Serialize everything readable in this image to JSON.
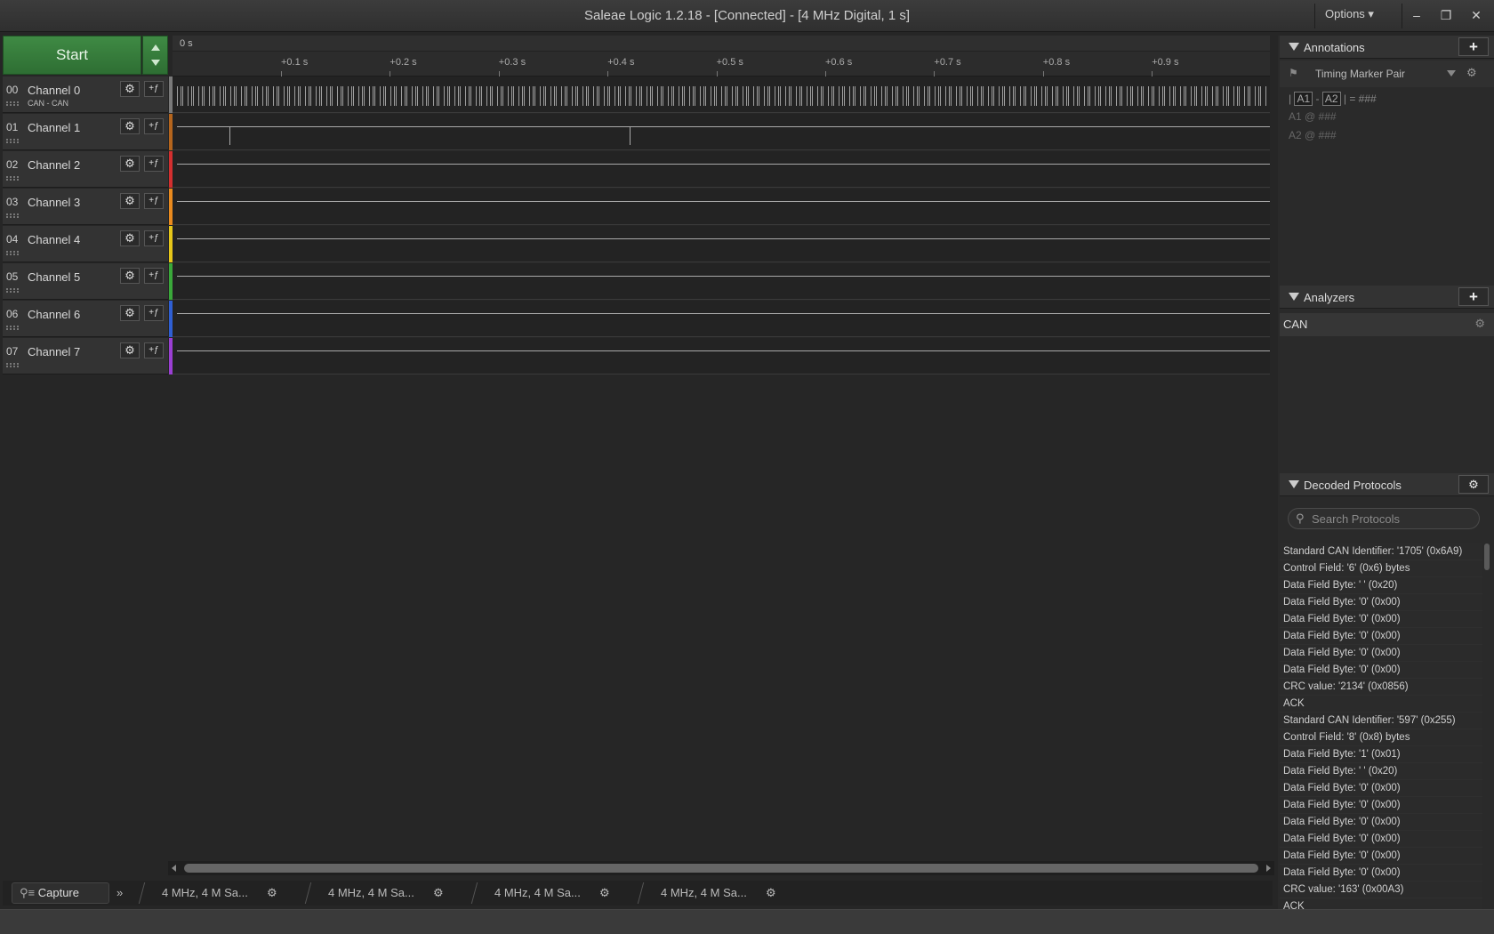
{
  "window": {
    "title": "Saleae Logic 1.2.18 - [Connected] - [4 MHz Digital, 1 s]",
    "options_label": "Options ▾",
    "minimize": "–",
    "restore": "❐",
    "close": "✕"
  },
  "toolbar": {
    "start_label": "Start"
  },
  "timeline": {
    "origin_label": "0 s",
    "ticks": [
      "+0.1 s",
      "+0.2 s",
      "+0.3 s",
      "+0.4 s",
      "+0.5 s",
      "+0.6 s",
      "+0.7 s",
      "+0.8 s",
      "+0.9 s"
    ]
  },
  "channels": [
    {
      "num": "00",
      "name": "Channel 0",
      "sub": "CAN - CAN",
      "color": "#7a7a7a"
    },
    {
      "num": "01",
      "name": "Channel 1",
      "sub": "",
      "color": "#b5651d"
    },
    {
      "num": "02",
      "name": "Channel 2",
      "sub": "",
      "color": "#d32f2f"
    },
    {
      "num": "03",
      "name": "Channel 3",
      "sub": "",
      "color": "#e98a1e"
    },
    {
      "num": "04",
      "name": "Channel 4",
      "sub": "",
      "color": "#e6c619"
    },
    {
      "num": "05",
      "name": "Channel 5",
      "sub": "",
      "color": "#3aa83a"
    },
    {
      "num": "06",
      "name": "Channel 6",
      "sub": "",
      "color": "#2f5fd3"
    },
    {
      "num": "07",
      "name": "Channel 7",
      "sub": "",
      "color": "#9b3fd3"
    }
  ],
  "icons": {
    "gear": "⚙",
    "trigger": "+ƒ",
    "add": "+",
    "pin": "▼",
    "search": "⚲"
  },
  "annotations": {
    "title": "Annotations",
    "marker_pair_label": "Timing Marker Pair",
    "line1_prefix": "|",
    "a1": "A1",
    "dash": "-",
    "a2": "A2",
    "line1_suffix": "| = ###",
    "line2": "A1  @  ###",
    "line3": "A2  @  ###"
  },
  "analyzers": {
    "title": "Analyzers",
    "items": [
      "CAN"
    ]
  },
  "decoded": {
    "title": "Decoded Protocols",
    "search_placeholder": "Search Protocols",
    "items": [
      "Standard CAN Identifier: '1705' (0x6A9)",
      "Control Field: '6' (0x6) bytes",
      "Data Field Byte: ' ' (0x20)",
      "Data Field Byte: '0' (0x00)",
      "Data Field Byte: '0' (0x00)",
      "Data Field Byte: '0' (0x00)",
      "Data Field Byte: '0' (0x00)",
      "Data Field Byte: '0' (0x00)",
      "CRC value: '2134' (0x0856)",
      "ACK",
      "Standard CAN Identifier: '597' (0x255)",
      "Control Field: '8' (0x8) bytes",
      "Data Field Byte: '1' (0x01)",
      "Data Field Byte: ' ' (0x20)",
      "Data Field Byte: '0' (0x00)",
      "Data Field Byte: '0' (0x00)",
      "Data Field Byte: '0' (0x00)",
      "Data Field Byte: '0' (0x00)",
      "Data Field Byte: '0' (0x00)",
      "Data Field Byte: '0' (0x00)",
      "CRC value: '163' (0x00A3)",
      "ACK"
    ]
  },
  "bottom": {
    "capture_label": "Capture",
    "more_label": "»",
    "sessions": [
      "4 MHz, 4 M Sa...",
      "4 MHz, 4 M Sa...",
      "4 MHz, 4 M Sa...",
      "4 MHz, 4 M Sa..."
    ]
  }
}
